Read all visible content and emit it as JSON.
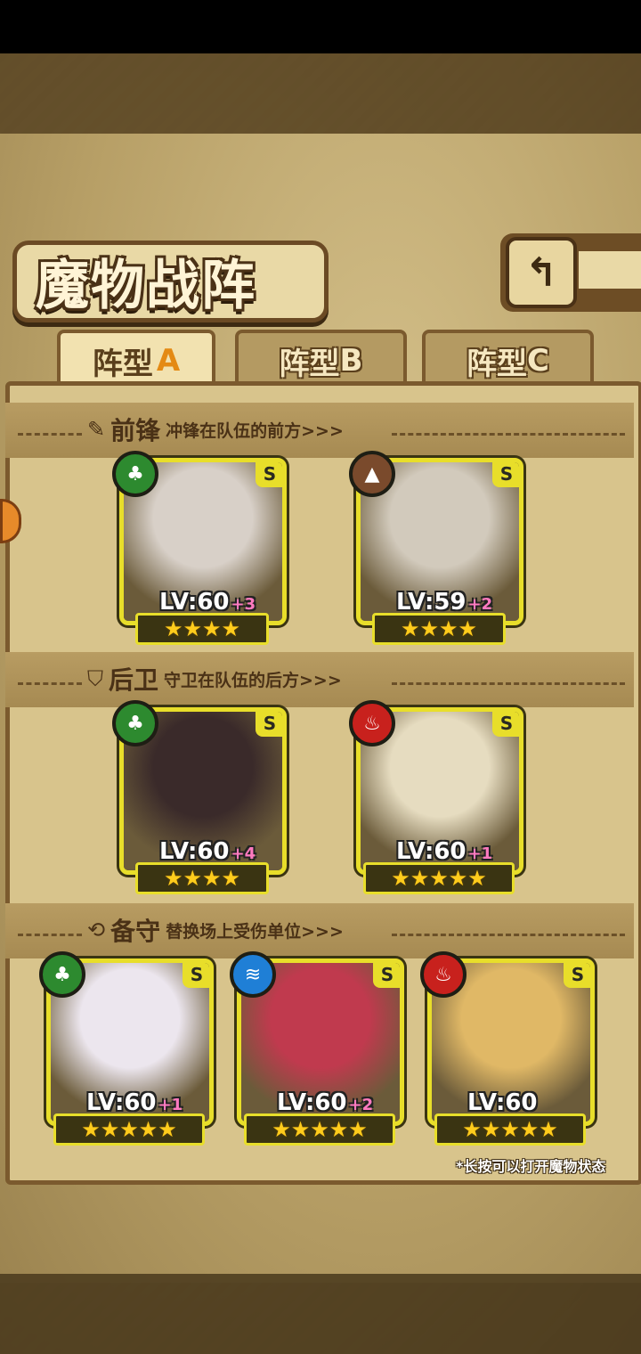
{
  "header": {
    "title": "魔物战阵",
    "back_icon": "↰"
  },
  "tabs": [
    {
      "label": "阵型",
      "letter": "A",
      "active": true
    },
    {
      "label": "阵型",
      "letter": "B",
      "active": false
    },
    {
      "label": "阵型",
      "letter": "C",
      "active": false
    }
  ],
  "sections": [
    {
      "name": "前锋",
      "desc": "冲锋在队伍的前方>>>",
      "icon": "pen-icon"
    },
    {
      "name": "后卫",
      "desc": "守卫在队伍的后方>>>",
      "icon": "shield-icon"
    },
    {
      "name": "备守",
      "desc": "替换场上受伤单位>>>",
      "icon": "swap-icon"
    }
  ],
  "cards": [
    {
      "level": "LV:60",
      "bonus": "+3",
      "rank": "S",
      "element": "leaf",
      "stars": "★★★★",
      "color": "#d8d0c8"
    },
    {
      "level": "LV:59",
      "bonus": "+2",
      "rank": "S",
      "element": "earth",
      "stars": "★★★★",
      "color": "#d2cabc"
    },
    {
      "level": "LV:60",
      "bonus": "+4",
      "rank": "S",
      "element": "leaf",
      "stars": "★★★★",
      "color": "#3a2a2a"
    },
    {
      "level": "LV:60",
      "bonus": "+1",
      "rank": "S",
      "element": "fire",
      "stars": "★★★★★",
      "color": "#e6dcc0"
    },
    {
      "level": "LV:60",
      "bonus": "+1",
      "rank": "S",
      "element": "leaf",
      "stars": "★★★★★",
      "color": "#ece6ee"
    },
    {
      "level": "LV:60",
      "bonus": "+2",
      "rank": "S",
      "element": "water",
      "stars": "★★★★★",
      "color": "#c03a4e"
    },
    {
      "level": "LV:60",
      "bonus": "",
      "rank": "S",
      "element": "fire",
      "stars": "★★★★★",
      "color": "#e0b866"
    }
  ],
  "footer": {
    "hint": "*长按可以打开魔物状态"
  }
}
